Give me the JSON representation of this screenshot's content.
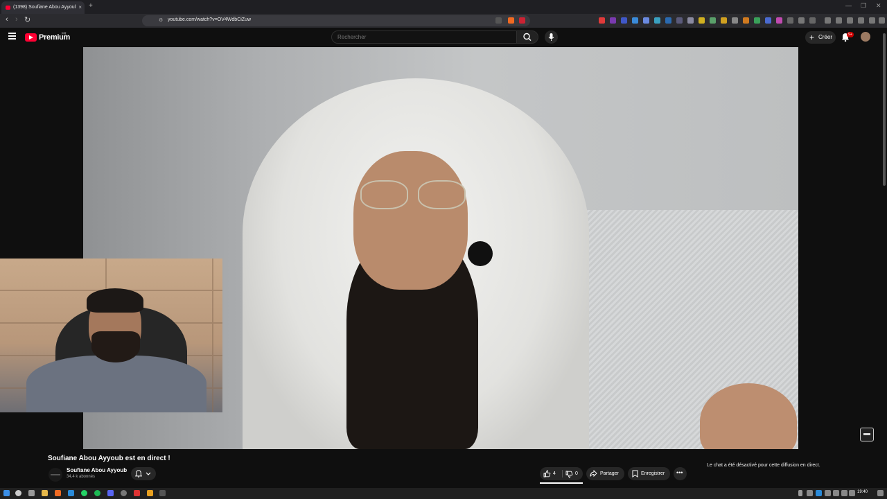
{
  "browser": {
    "tab_title": "(1398) Soufiane Abou Ayyoub",
    "url": "youtube.com/watch?v=OV4WdbCiZuw",
    "new_tab_symbol": "+",
    "close_tab_symbol": "×"
  },
  "youtube": {
    "logo_text": "Premium",
    "country_code": "FR",
    "search_placeholder": "Rechercher",
    "create_label": "Créer",
    "notification_badge": "9+"
  },
  "video": {
    "title": "Soufiane Abou Ayyoub est en direct !",
    "channel_name": "Soufiane Abou Ayyoub",
    "subscribers": "34,4 k abonnés",
    "likes": "4",
    "dislikes": "0",
    "share_label": "Partager",
    "save_label": "Enregistrer",
    "chat_disabled_message": "Le chat a été désactivé pour cette diffusion en direct."
  },
  "taskbar": {
    "time": "19:40"
  }
}
